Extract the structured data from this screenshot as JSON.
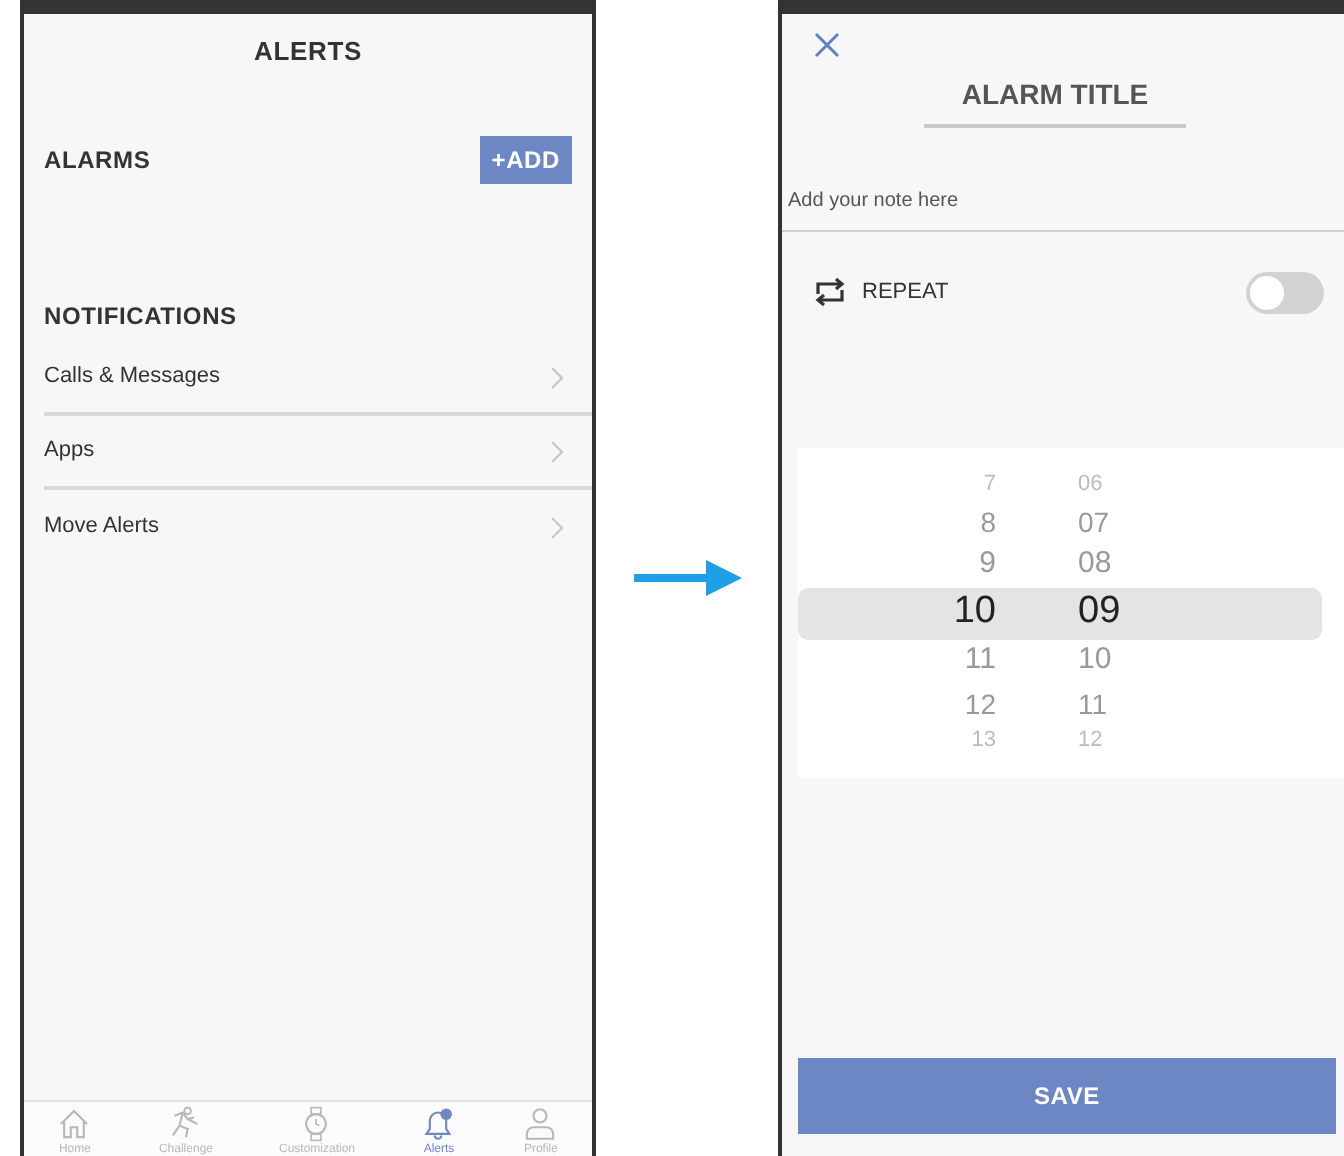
{
  "alerts_screen": {
    "title": "ALERTS",
    "alarms": {
      "heading": "ALARMS",
      "add_button": "+ADD"
    },
    "notifications": {
      "heading": "NOTIFICATIONS",
      "items": [
        {
          "label": "Calls & Messages"
        },
        {
          "label": "Apps"
        },
        {
          "label": "Move Alerts"
        }
      ]
    },
    "tab_bar": [
      {
        "kind": "home",
        "label": "Home",
        "selected": false
      },
      {
        "kind": "challenge",
        "label": "Challenge",
        "selected": false
      },
      {
        "kind": "watch",
        "label": "Customization",
        "selected": false
      },
      {
        "kind": "alerts",
        "label": "Alerts",
        "selected": true
      },
      {
        "kind": "profile",
        "label": "Profile",
        "selected": false
      }
    ]
  },
  "alarm_screen": {
    "title": "ALARM TITLE",
    "note": {
      "placeholder": "Add your note here"
    },
    "repeat": {
      "label": "REPEAT",
      "on": false
    },
    "picker": [
      {
        "hour": "7",
        "minute": "06",
        "selected": false
      },
      {
        "hour": "8",
        "minute": "07",
        "selected": false
      },
      {
        "hour": "9",
        "minute": "08",
        "selected": false
      },
      {
        "hour": "10",
        "minute": "09",
        "selected": true
      },
      {
        "hour": "11",
        "minute": "10",
        "selected": false
      },
      {
        "hour": "12",
        "minute": "11",
        "selected": false
      },
      {
        "hour": "13",
        "minute": "12",
        "selected": false
      }
    ],
    "save_button": "SAVE"
  }
}
